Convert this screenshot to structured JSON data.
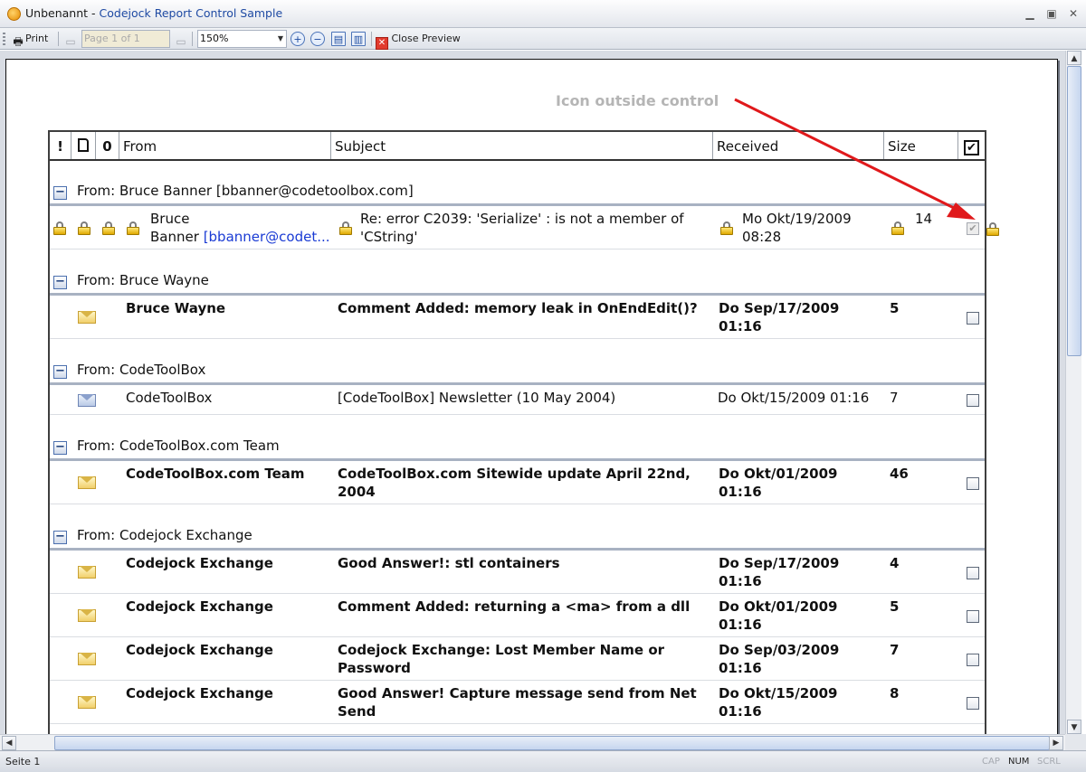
{
  "window": {
    "document_name": "Unbenannt",
    "separator": "-",
    "app_name": "Codejock Report Control Sample"
  },
  "toolbar": {
    "print_label": "Print",
    "page_field": "Page 1 of 1",
    "zoom_value": "150%",
    "close_preview_label": "Close Preview"
  },
  "annotation": {
    "text": "Icon outside control",
    "color": "#b5b5b5",
    "arrow_color": "#e0191b"
  },
  "columns": {
    "importance": "!",
    "icon": "🗋",
    "attachment": "0",
    "from": "From",
    "subject": "Subject",
    "received": "Received",
    "size": "Size",
    "check": "✔"
  },
  "groups": [
    {
      "label": "From: Bruce Banner [bbanner@codetoolbox.com]"
    },
    {
      "label": "From: Bruce Wayne"
    },
    {
      "label": "From: CodeToolBox"
    },
    {
      "label": "From: CodeToolBox.com Team"
    },
    {
      "label": "From: Codejock Exchange"
    }
  ],
  "rows": [
    {
      "from_line1": "Bruce",
      "from_line2": "Banner",
      "from_email": "[bbanner@codet...",
      "subject": "Re: error C2039: 'Serialize' : is not a member of 'CString'",
      "received_line1": "Mo Okt/19/2009",
      "received_line2": "08:28",
      "size": "14",
      "checked": true,
      "locked": true
    },
    {
      "from": "Bruce Wayne",
      "subject": "Comment Added: memory leak in OnEndEdit()?",
      "received_line1": "Do Sep/17/2009",
      "received_line2": "01:16",
      "size": "5",
      "unread": true
    },
    {
      "from": "CodeToolBox",
      "subject": "[CodeToolBox] Newsletter (10 May 2004)",
      "received_line1": "Do Okt/15/2009 01:16",
      "size": "7",
      "unread": false
    },
    {
      "from": "CodeToolBox.com Team",
      "subject_line1": "CodeToolBox.com Sitewide update April 22nd,",
      "subject_line2": "2004",
      "received_line1": "Do Okt/01/2009",
      "received_line2": "01:16",
      "size": "46",
      "unread": true
    },
    {
      "from": "Codejock Exchange",
      "subject": "Good Answer!: stl containers",
      "received_line1": "Do Sep/17/2009",
      "received_line2": "01:16",
      "size": "4",
      "unread": true
    },
    {
      "from": "Codejock Exchange",
      "subject": "Comment Added: returning a <ma> from a dll",
      "received_line1": "Do Okt/01/2009",
      "received_line2": "01:16",
      "size": "5",
      "unread": true
    },
    {
      "from": "Codejock Exchange",
      "subject_line1": "Codejock Exchange:  Lost Member Name or",
      "subject_line2": "Password",
      "received_line1": "Do Sep/03/2009",
      "received_line2": "01:16",
      "size": "7",
      "unread": true
    },
    {
      "from": "Codejock Exchange",
      "subject_line1": "Good Answer! Capture message send from Net",
      "subject_line2": "Send",
      "received_line1": "Do Okt/15/2009",
      "received_line2": "01:16",
      "size": "8",
      "unread": true
    }
  ],
  "statusbar": {
    "text": "Seite 1",
    "cap": "CAP",
    "num": "NUM",
    "scrl": "SCRL"
  }
}
